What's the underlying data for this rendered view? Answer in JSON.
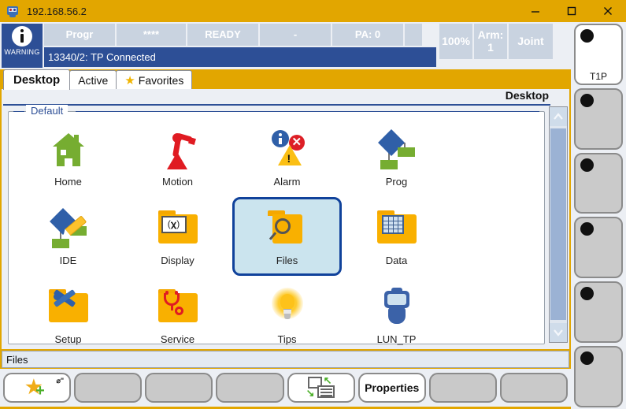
{
  "window": {
    "title": "192.168.56.2",
    "icon": "teach-pendant-icon",
    "minimize_label": "─",
    "maximize_label": "□",
    "close_label": "✕",
    "accent_color": "#e2a600"
  },
  "status": {
    "warning_label": "WARNING",
    "cells": [
      {
        "label": "Progr"
      },
      {
        "label": "****"
      },
      {
        "label": "READY"
      },
      {
        "label": "-"
      },
      {
        "label": "PA: 0"
      },
      {
        "label": ""
      }
    ],
    "message": "13340/2: TP Connected",
    "right_cells": [
      {
        "label": "100%"
      },
      {
        "label": "Arm: 1"
      },
      {
        "label": "Joint"
      }
    ],
    "message_bg": "#2d4f96",
    "cell_bg": "#c9d3e0"
  },
  "tabs": [
    {
      "label": "Desktop",
      "active": true,
      "icon": ""
    },
    {
      "label": "Active",
      "active": false,
      "icon": ""
    },
    {
      "label": "Favorites",
      "active": false,
      "icon": "star-icon"
    }
  ],
  "panel": {
    "title": "Desktop",
    "group_label": "Default",
    "scroll": {
      "up": "▲",
      "down": "▼"
    }
  },
  "icons": [
    {
      "label": "Home",
      "art": "house-icon",
      "selected": false
    },
    {
      "label": "Motion",
      "art": "robot-arm-icon",
      "selected": false
    },
    {
      "label": "Alarm",
      "art": "alarm-icon",
      "selected": false
    },
    {
      "label": "Prog",
      "art": "flowchart-icon",
      "selected": false
    },
    {
      "label": "IDE",
      "art": "flowchart-pencil-icon",
      "selected": false
    },
    {
      "label": "Display",
      "art": "folder-display-icon",
      "selected": false
    },
    {
      "label": "Files",
      "art": "folder-search-icon",
      "selected": true
    },
    {
      "label": "Data",
      "art": "folder-grid-icon",
      "selected": false
    },
    {
      "label": "Setup",
      "art": "folder-tools-icon",
      "selected": false
    },
    {
      "label": "Service",
      "art": "folder-stethoscope-icon",
      "selected": false
    },
    {
      "label": "Tips",
      "art": "lightbulb-icon",
      "selected": false
    },
    {
      "label": "LUN_TP",
      "art": "teach-pendant-icon",
      "selected": false
    }
  ],
  "statusline": {
    "text": "Files"
  },
  "toolbar": [
    {
      "label": "",
      "icon": "add-favorite-icon",
      "style": "white",
      "corner": "⌀\""
    },
    {
      "label": "",
      "icon": "",
      "style": "gray",
      "corner": ""
    },
    {
      "label": "",
      "icon": "",
      "style": "gray",
      "corner": ""
    },
    {
      "label": "",
      "icon": "",
      "style": "gray",
      "corner": ""
    },
    {
      "label": "",
      "icon": "grid-list-toggle-icon",
      "style": "white",
      "corner": ""
    },
    {
      "label": "Properties",
      "icon": "",
      "style": "white",
      "corner": ""
    },
    {
      "label": "",
      "icon": "",
      "style": "gray",
      "corner": ""
    },
    {
      "label": "",
      "icon": "",
      "style": "gray",
      "corner": ""
    }
  ],
  "sidebar": [
    {
      "label": "T1P",
      "style": "white"
    },
    {
      "label": "",
      "style": "gray"
    },
    {
      "label": "",
      "style": "gray"
    },
    {
      "label": "",
      "style": "gray"
    },
    {
      "label": "",
      "style": "gray"
    },
    {
      "label": "",
      "style": "gray"
    }
  ]
}
